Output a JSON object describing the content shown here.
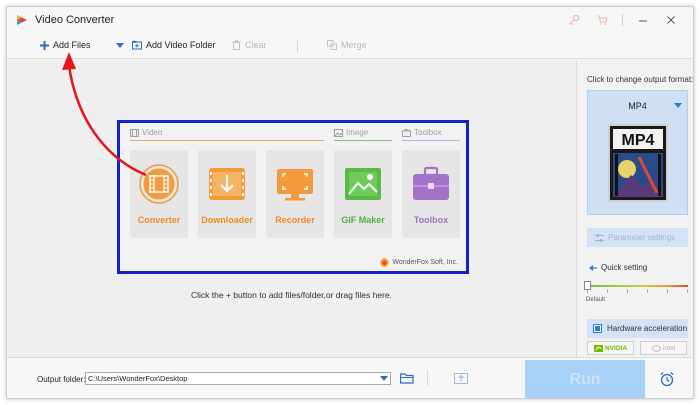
{
  "window": {
    "title": "Video Converter"
  },
  "toolbar": {
    "add_files": "Add Files",
    "add_video_folder": "Add Video Folder",
    "clear": "Clear",
    "merge": "Merge"
  },
  "launcher": {
    "sections": {
      "video": "Video",
      "image": "Image",
      "toolbox": "Toolbox"
    },
    "tiles": [
      {
        "label": "Converter",
        "icon": "film-icon"
      },
      {
        "label": "Downloader",
        "icon": "download-icon"
      },
      {
        "label": "Recorder",
        "icon": "screen-record-icon"
      },
      {
        "label": "GIF Maker",
        "icon": "image-icon"
      },
      {
        "label": "Toolbox",
        "icon": "toolbox-icon"
      }
    ],
    "brand": "WonderFox Soft, Inc."
  },
  "main": {
    "hint": "Click the + button to add files/folder,or drag files here."
  },
  "right_panel": {
    "caption": "Click to change output format:",
    "format": "MP4",
    "format_image_text": "MP4",
    "parameter_settings": "Parameter settings",
    "quick_setting": "Quick setting",
    "default_label": "Default",
    "hardware_acceleration": "Hardware acceleration",
    "nvidia": "NVIDIA",
    "intel": "Intel"
  },
  "bottom": {
    "output_folder_label": "Output folder:",
    "output_path": "C:\\Users\\WonderFox\\Desktop",
    "run": "Run"
  },
  "colors": {
    "accent_blue": "#2a7ce0",
    "highlight_border": "#1422c9",
    "orange": "#f39a3c",
    "green": "#59bb45",
    "purple": "#a372c9",
    "annotation_red": "#e4161c"
  }
}
